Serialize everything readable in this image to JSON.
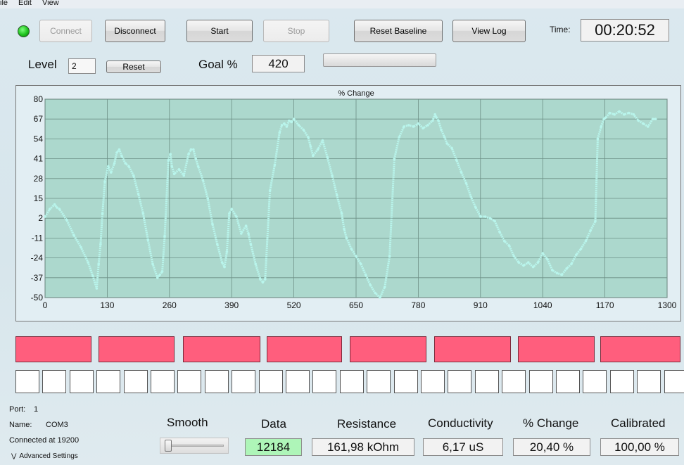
{
  "menu": {
    "file": "ile",
    "edit": "Edit",
    "view": "View"
  },
  "toolbar": {
    "connect": "Connect",
    "disconnect": "Disconnect",
    "start": "Start",
    "stop": "Stop",
    "reset_baseline": "Reset Baseline",
    "view_log": "View Log",
    "time_label": "Time:",
    "time_value": "00:20:52"
  },
  "level": {
    "label": "Level",
    "value": "2",
    "reset": "Reset"
  },
  "goal": {
    "label": "Goal %",
    "value": "420",
    "progress": 0
  },
  "status": {
    "connected": true,
    "led_color": "#1ec21e"
  },
  "chart_data": {
    "type": "scatter",
    "title": "% Change",
    "xlim": [
      0,
      1300
    ],
    "ylim": [
      -50,
      80
    ],
    "x_ticks": [
      0,
      130,
      260,
      390,
      520,
      650,
      780,
      910,
      1040,
      1170,
      1300
    ],
    "y_ticks": [
      80,
      67,
      54,
      41,
      28,
      15,
      2,
      -11,
      -24,
      -37,
      -50
    ],
    "grid": true,
    "plot_bg": "#acd8cd",
    "series_color": "#b9f5ec",
    "series": [
      {
        "x": [
          0,
          10,
          20,
          25,
          30,
          45,
          60,
          75,
          90,
          100,
          108,
          112,
          116,
          120,
          125,
          132,
          138,
          145,
          150,
          155,
          160,
          168,
          175,
          185,
          195,
          205,
          215,
          225,
          235,
          240,
          245,
          250,
          258,
          262,
          265,
          270,
          280,
          290,
          300,
          305,
          310,
          315,
          320,
          330,
          340,
          350,
          360,
          370,
          375,
          380,
          385,
          390,
          400,
          410,
          420,
          425,
          430,
          440,
          450,
          455,
          460,
          470,
          480,
          490,
          495,
          500,
          505,
          510,
          515,
          520,
          530,
          540,
          550,
          555,
          560,
          570,
          580,
          590,
          600,
          610,
          620,
          625,
          630,
          640,
          650,
          660,
          670,
          680,
          690,
          700,
          710,
          720,
          730,
          740,
          750,
          760,
          770,
          780,
          790,
          800,
          810,
          815,
          818,
          822,
          828,
          835,
          840,
          850,
          860,
          870,
          880,
          890,
          900,
          910,
          920,
          930,
          940,
          950,
          960,
          970,
          980,
          990,
          1000,
          1010,
          1020,
          1030,
          1040,
          1050,
          1060,
          1070,
          1080,
          1090,
          1100,
          1110,
          1120,
          1130,
          1140,
          1150,
          1155,
          1162,
          1168,
          1172,
          1180,
          1190,
          1200,
          1210,
          1220,
          1230,
          1240,
          1250,
          1260,
          1270,
          1276
        ],
        "y": [
          3,
          8,
          11,
          9,
          8,
          1,
          -9,
          -17,
          -27,
          -36,
          -44,
          -28,
          -15,
          5,
          26,
          36,
          32,
          38,
          45,
          47,
          43,
          38,
          36,
          30,
          18,
          5,
          -12,
          -28,
          -37,
          -35,
          -33,
          -10,
          40,
          44,
          36,
          31,
          34,
          30,
          44,
          47,
          47,
          41,
          36,
          27,
          15,
          -2,
          -15,
          -27,
          -30,
          -20,
          5,
          8,
          3,
          -8,
          -3,
          -8,
          -15,
          -28,
          -38,
          -40,
          -38,
          20,
          37,
          58,
          63,
          64,
          62,
          66,
          65,
          67,
          63,
          60,
          55,
          49,
          43,
          47,
          53,
          42,
          30,
          17,
          5,
          -5,
          -11,
          -18,
          -23,
          -28,
          -35,
          -42,
          -47,
          -50,
          -43,
          -23,
          41,
          55,
          62,
          63,
          62,
          64,
          61,
          63,
          66,
          70,
          68,
          66,
          60,
          55,
          51,
          48,
          40,
          32,
          25,
          16,
          9,
          3,
          3,
          2,
          0,
          -7,
          -13,
          -16,
          -23,
          -27,
          -29,
          -27,
          -30,
          -27,
          -21,
          -25,
          -32,
          -34,
          -35,
          -31,
          -28,
          -22,
          -18,
          -13,
          -6,
          0,
          54,
          62,
          67,
          68,
          71,
          70,
          72,
          70,
          71,
          70,
          66,
          64,
          62,
          67,
          67
        ]
      }
    ]
  },
  "indicators": {
    "red_bars": 8,
    "white_cells": 25,
    "red_color": "#ff5e7d"
  },
  "info": {
    "port_label": "Port:",
    "port_value": "1",
    "name_label": "Name:",
    "name_value": "COM3",
    "connected_at": "Connected at 19200",
    "advanced": "Advanced Settings"
  },
  "smooth": {
    "label": "Smooth",
    "value": 0
  },
  "readouts": {
    "data_label": "Data",
    "data_value": "12184",
    "data_bg": "#aef5b8",
    "resistance_label": "Resistance",
    "resistance_value": "161,98 kOhm",
    "conductivity_label": "Conductivity",
    "conductivity_value": "6,17 uS",
    "pct_label": "% Change",
    "pct_value": "20,40 %",
    "calibrated_label": "Calibrated",
    "calibrated_value": "100,00 %"
  }
}
